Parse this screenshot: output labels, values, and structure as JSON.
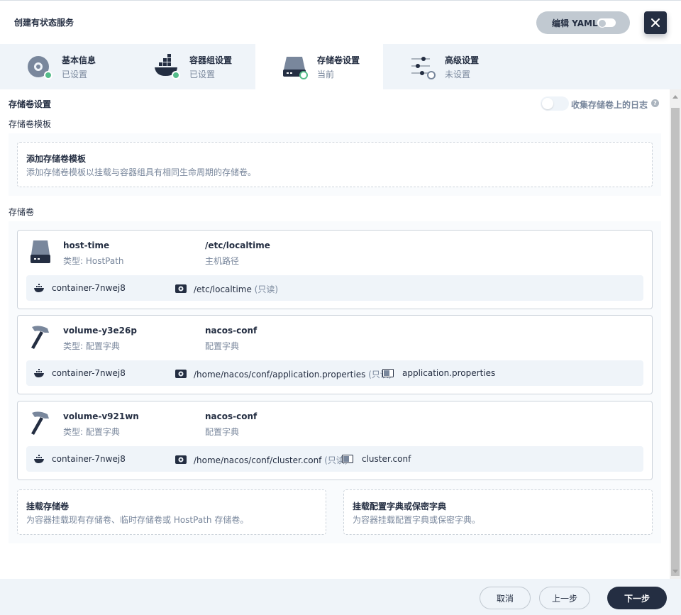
{
  "header": {
    "title": "创建有状态服务",
    "yaml_label": "编辑 YAML"
  },
  "tabs": [
    {
      "name": "基本信息",
      "status": "已设置",
      "icon": "gear-icon"
    },
    {
      "name": "容器组设置",
      "status": "已设置",
      "icon": "docker-icon"
    },
    {
      "name": "存储卷设置",
      "status": "当前",
      "icon": "disk-icon"
    },
    {
      "name": "高级设置",
      "status": "未设置",
      "icon": "sliders-icon"
    }
  ],
  "storage": {
    "title": "存储卷设置",
    "log_label": "收集存储卷上的日志",
    "template_section": "存储卷模板",
    "template_add_title": "添加存储卷模板",
    "template_add_desc": "添加存储卷模板以挂载与容器组具有相同生命周期的存储卷。",
    "volumes_section": "存储卷",
    "volumes": [
      {
        "name": "host-time",
        "type": "类型: HostPath",
        "path": "/etc/localtime",
        "path_label": "主机路径",
        "icon": "disk-icon",
        "container": "container-7nwej8",
        "mount_path": "/etc/localtime",
        "readonly": "(只读)",
        "file": ""
      },
      {
        "name": "volume-y3e26p",
        "type": "类型: 配置字典",
        "path": "nacos-conf",
        "path_label": "配置字典",
        "icon": "hammer-icon",
        "container": "container-7nwej8",
        "mount_path": "/home/nacos/conf/application.properties",
        "readonly": "(只读)",
        "file": "application.properties"
      },
      {
        "name": "volume-v921wn",
        "type": "类型: 配置字典",
        "path": "nacos-conf",
        "path_label": "配置字典",
        "icon": "hammer-icon",
        "container": "container-7nwej8",
        "mount_path": "/home/nacos/conf/cluster.conf",
        "readonly": "(只读)",
        "file": "cluster.conf"
      }
    ],
    "mount_volume_title": "挂载存储卷",
    "mount_volume_desc": "为容器挂载现有存储卷、临时存储卷或 HostPath 存储卷。",
    "mount_config_title": "挂载配置字典或保密字典",
    "mount_config_desc": "为容器挂载配置字典或保密字典。"
  },
  "footer": {
    "cancel": "取消",
    "prev": "上一步",
    "next": "下一步"
  }
}
